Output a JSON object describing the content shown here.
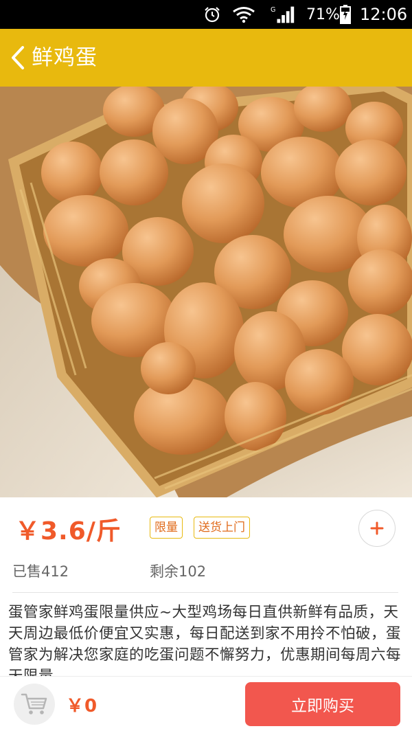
{
  "status_bar": {
    "icons": [
      "alarm-icon",
      "wifi-icon",
      "signal-icon",
      "battery-icon"
    ],
    "network_type": "G",
    "battery_percent": "71%",
    "time": "12:06"
  },
  "header": {
    "back_icon": "chevron-left-icon",
    "title": "鲜鸡蛋",
    "background_color": "#e8b90e"
  },
  "product": {
    "image": "basket-of-brown-eggs",
    "price": "￥3.6/斤",
    "tags": [
      "限量",
      "送货上门"
    ],
    "add_icon": "plus-icon",
    "sold": "已售412",
    "remaining": "剩余102",
    "description": "蛋管家鲜鸡蛋限量供应~大型鸡场每日直供新鲜有品质，天天周边最低价便宜又实惠，每日配送到家不用拎不怕破，蛋管家为解决您家庭的吃蛋问题不懈努力，优惠期间每周六每天限量"
  },
  "bottom_bar": {
    "cart_icon": "shopping-cart-icon",
    "total": "￥0",
    "buy_label": "立即购买",
    "accent_color": "#f2574e"
  }
}
